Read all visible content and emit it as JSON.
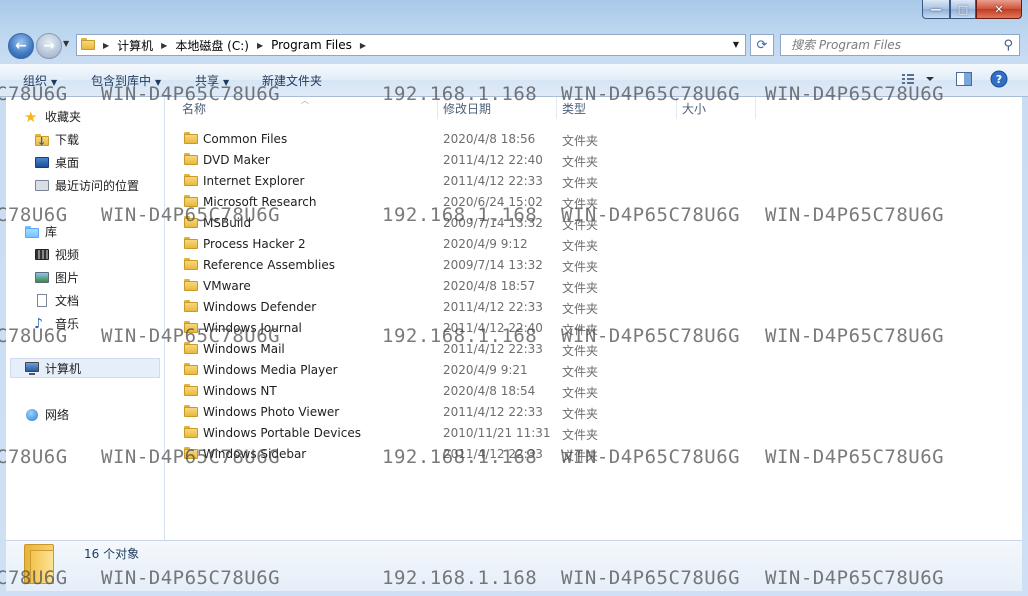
{
  "window": {
    "caption_buttons": {
      "minimize": "—",
      "maximize": "□",
      "close": "✕"
    }
  },
  "address": {
    "crumbs": [
      "计算机",
      "本地磁盘 (C:)",
      "Program Files"
    ],
    "search_placeholder": "搜索 Program Files"
  },
  "toolbar": {
    "organize": "组织",
    "include_in_library": "包含到库中",
    "share": "共享",
    "new_folder": "新建文件夹"
  },
  "nav": {
    "favorites": "收藏夹",
    "downloads": "下载",
    "desktop": "桌面",
    "recent": "最近访问的位置",
    "libraries": "库",
    "videos": "视频",
    "pictures": "图片",
    "documents": "文档",
    "music": "音乐",
    "computer": "计算机",
    "network": "网络"
  },
  "columns": {
    "name": "名称",
    "date": "修改日期",
    "type": "类型",
    "size": "大小"
  },
  "files": [
    {
      "name": "Common Files",
      "date": "2020/4/8 18:56",
      "type": "文件夹"
    },
    {
      "name": "DVD Maker",
      "date": "2011/4/12 22:40",
      "type": "文件夹"
    },
    {
      "name": "Internet Explorer",
      "date": "2011/4/12 22:33",
      "type": "文件夹"
    },
    {
      "name": "Microsoft Research",
      "date": "2020/6/24 15:02",
      "type": "文件夹"
    },
    {
      "name": "MSBuild",
      "date": "2009/7/14 13:32",
      "type": "文件夹"
    },
    {
      "name": "Process Hacker 2",
      "date": "2020/4/9 9:12",
      "type": "文件夹"
    },
    {
      "name": "Reference Assemblies",
      "date": "2009/7/14 13:32",
      "type": "文件夹"
    },
    {
      "name": "VMware",
      "date": "2020/4/8 18:57",
      "type": "文件夹"
    },
    {
      "name": "Windows Defender",
      "date": "2011/4/12 22:33",
      "type": "文件夹"
    },
    {
      "name": "Windows Journal",
      "date": "2011/4/12 22:40",
      "type": "文件夹"
    },
    {
      "name": "Windows Mail",
      "date": "2011/4/12 22:33",
      "type": "文件夹"
    },
    {
      "name": "Windows Media Player",
      "date": "2020/4/9 9:21",
      "type": "文件夹"
    },
    {
      "name": "Windows NT",
      "date": "2020/4/8 18:54",
      "type": "文件夹"
    },
    {
      "name": "Windows Photo Viewer",
      "date": "2011/4/12 22:33",
      "type": "文件夹"
    },
    {
      "name": "Windows Portable Devices",
      "date": "2010/11/21 11:31",
      "type": "文件夹"
    },
    {
      "name": "Windows Sidebar",
      "date": "2011/4/12 22:33",
      "type": "文件夹"
    }
  ],
  "details": {
    "count": "16 个对象"
  },
  "watermark": {
    "host_fragment": "C78U6G",
    "host": "WIN-D4P65C78U6G",
    "ip": "192.168.1.168"
  },
  "colors": {
    "accent": "#3f79c2",
    "folder": "#e8b940",
    "text_muted": "#6d6d6d"
  }
}
